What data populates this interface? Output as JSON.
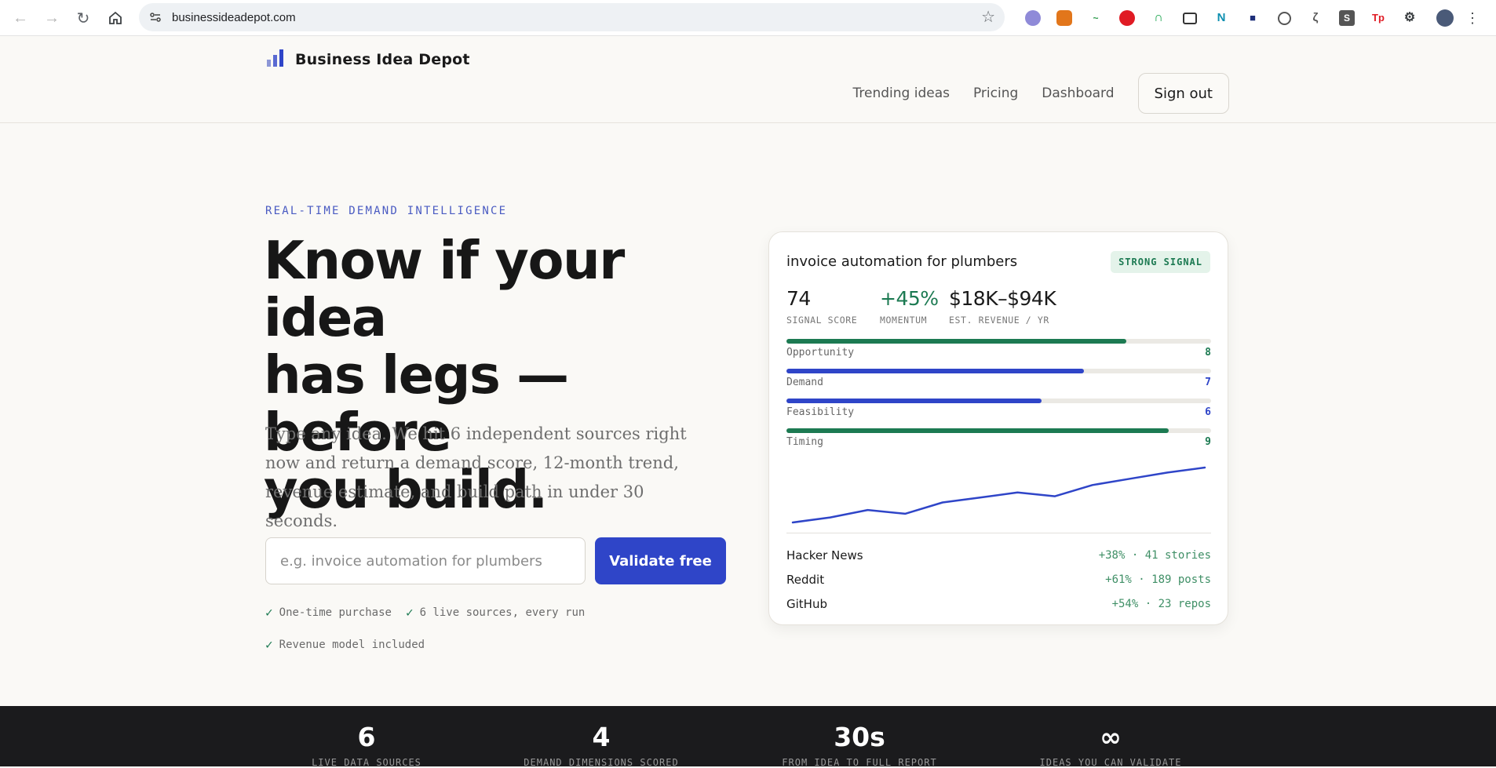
{
  "browser": {
    "url": "businessideadepot.com"
  },
  "header": {
    "brand_name": "Business Idea Depot",
    "nav": [
      {
        "label": "Trending ideas"
      },
      {
        "label": "Pricing"
      },
      {
        "label": "Dashboard"
      }
    ],
    "signout_label": "Sign out"
  },
  "hero": {
    "eyebrow": "REAL-TIME DEMAND INTELLIGENCE",
    "headline_line1": "Know if your idea",
    "headline_line2": "has legs — before",
    "headline_line3": "you build.",
    "subcopy": "Type any idea. We hit 6 independent sources right now and return a demand score, 12-month trend, revenue estimate, and build path in under 30 seconds.",
    "input_placeholder": "e.g. invoice automation for plumbers",
    "cta_label": "Validate free",
    "checks": [
      "One-time purchase",
      "6 live sources, every run",
      "Revenue model included"
    ]
  },
  "card": {
    "title": "invoice automation for plumbers",
    "badge": "STRONG SIGNAL",
    "metrics": [
      {
        "value": "74",
        "label": "SIGNAL SCORE"
      },
      {
        "value": "+45%",
        "label": "MOMENTUM"
      },
      {
        "value": "$18K–$94K",
        "label": "EST. REVENUE / YR"
      }
    ],
    "dimensions": [
      {
        "label": "Opportunity",
        "score": "8",
        "fill": 0.8,
        "color": "#1c7a52"
      },
      {
        "label": "Demand",
        "score": "7",
        "fill": 0.7,
        "color": "#2f45c8"
      },
      {
        "label": "Feasibility",
        "score": "6",
        "fill": 0.6,
        "color": "#2f45c8"
      },
      {
        "label": "Timing",
        "score": "9",
        "fill": 0.9,
        "color": "#1c7a52"
      }
    ],
    "trend_values": [
      10,
      14,
      20,
      17,
      26,
      30,
      34,
      31,
      40,
      45,
      50,
      54
    ],
    "sources": [
      {
        "name": "Hacker News",
        "stat": "+38% · 41 stories"
      },
      {
        "name": "Reddit",
        "stat": "+61% · 189 posts"
      },
      {
        "name": "GitHub",
        "stat": "+54% · 23 repos"
      }
    ]
  },
  "stats": [
    {
      "num": "6",
      "cap": "LIVE DATA SOURCES"
    },
    {
      "num": "4",
      "cap": "DEMAND DIMENSIONS SCORED"
    },
    {
      "num": "30s",
      "cap": "FROM IDEA TO FULL REPORT"
    },
    {
      "num": "∞",
      "cap": "IDEAS YOU CAN VALIDATE"
    }
  ],
  "colors": {
    "accent": "#2f45c8",
    "positive": "#1c7a52",
    "stats_bg": "#1b1b1d"
  }
}
